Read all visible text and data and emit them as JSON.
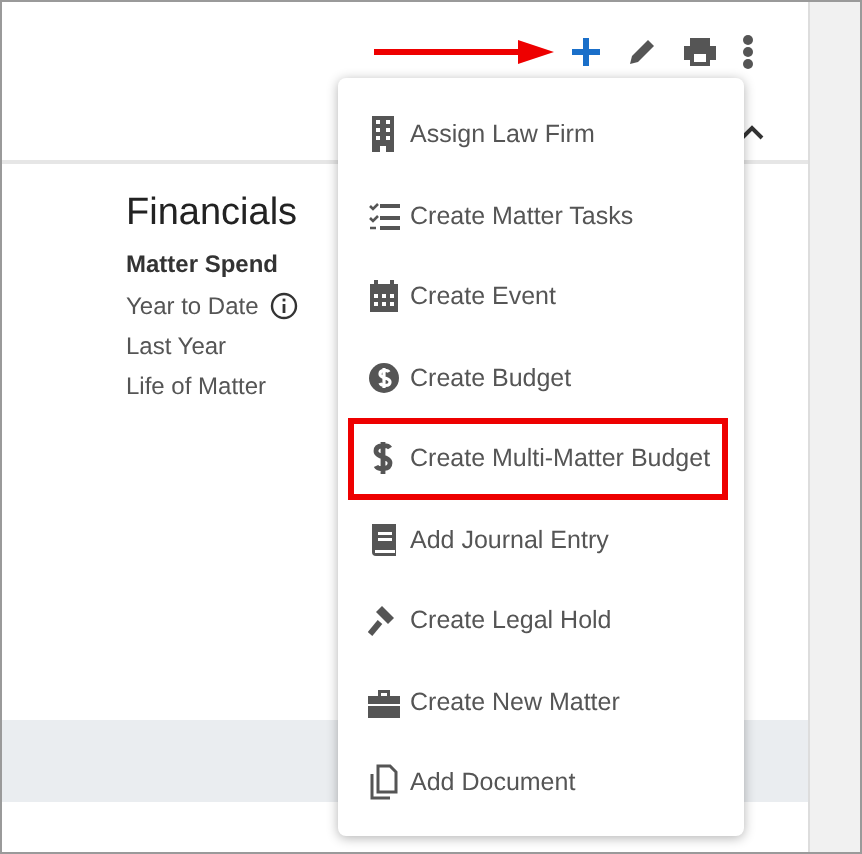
{
  "toolbar": {
    "annotation_arrow": true
  },
  "section": {
    "title": "Financials",
    "subtitle": "Matter Spend",
    "rows": [
      {
        "label": "Year to Date",
        "info": true
      },
      {
        "label": "Last Year",
        "info": false
      },
      {
        "label": "Life of Matter",
        "info": false
      }
    ]
  },
  "menu": {
    "items": [
      {
        "label": "Assign Law Firm",
        "highlighted": false
      },
      {
        "label": "Create Matter Tasks",
        "highlighted": false
      },
      {
        "label": "Create Event",
        "highlighted": false
      },
      {
        "label": "Create Budget",
        "highlighted": false
      },
      {
        "label": "Create Multi-Matter Budget",
        "highlighted": true
      },
      {
        "label": "Add Journal Entry",
        "highlighted": false
      },
      {
        "label": "Create Legal Hold",
        "highlighted": false
      },
      {
        "label": "Create New Matter",
        "highlighted": false
      },
      {
        "label": "Add Document",
        "highlighted": false
      }
    ]
  }
}
